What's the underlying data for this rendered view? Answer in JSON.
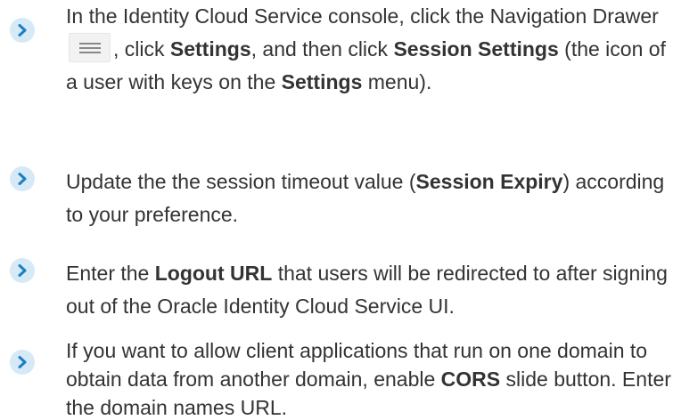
{
  "colors": {
    "text": "#333333",
    "bullet_bg": "#d5e9f7",
    "bullet_chevron": "#1d7fc1"
  },
  "steps": [
    {
      "icon": "chevron-right-icon",
      "t1": "In the Identity Cloud Service console, click the Navigation Drawer ",
      "nav_icon": "hamburger-menu-icon",
      "t2": ", click ",
      "b1": "Settings",
      "t3": ", and then click ",
      "b2": "Session Settings",
      "t4": " (the icon of a user with keys on the ",
      "b3": "Settings",
      "t5": " menu)."
    },
    {
      "icon": "chevron-right-icon",
      "t1": "Update the the session timeout value (",
      "b1": "Session Expiry",
      "t2": ") according to your preference."
    },
    {
      "icon": "chevron-right-icon",
      "t1": "Enter the ",
      "b1": "Logout URL",
      "t2": " that users will be redirected to after signing out of the Oracle Identity Cloud Service UI."
    },
    {
      "icon": "chevron-right-icon",
      "t1": "If you want to allow client applications that run on one domain to obtain data from another domain, enable ",
      "b1": "CORS",
      "t2": " slide button. Enter the domain names URL."
    }
  ]
}
